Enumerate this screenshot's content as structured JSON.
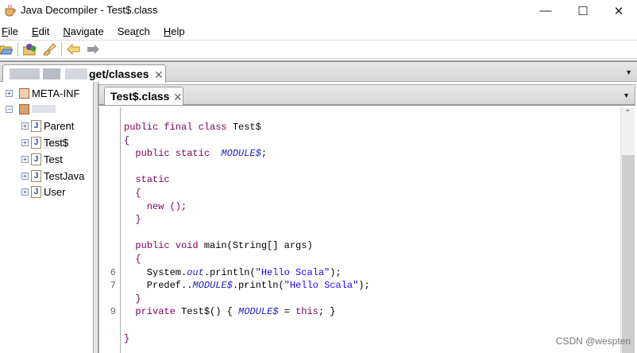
{
  "window": {
    "title": "Java Decompiler - Test$.class",
    "controls": [
      "minimize",
      "maximize",
      "close"
    ]
  },
  "menu": [
    {
      "label": "File",
      "mnemonic": "F",
      "rest": "ile"
    },
    {
      "label": "Edit",
      "mnemonic": "E",
      "rest": "dit"
    },
    {
      "label": "Navigate",
      "mnemonic": "N",
      "rest": "avigate"
    },
    {
      "label": "Search",
      "pre": "Sea",
      "mnemonic": "r",
      "rest": "ch"
    },
    {
      "label": "Help",
      "mnemonic": "H",
      "rest": "elp"
    }
  ],
  "toolbar": [
    "open-file-icon",
    "open-type-icon",
    "search-icon",
    "back-icon",
    "forward-icon"
  ],
  "outer_tab": {
    "label": "get/classes"
  },
  "tree": [
    {
      "label": "META-INF",
      "level": 0,
      "expanded": false,
      "icon": "package-icon"
    },
    {
      "label": "",
      "level": 0,
      "expanded": true,
      "icon": "package-icon"
    },
    {
      "label": "Parent",
      "level": 1,
      "icon": "java-class-icon"
    },
    {
      "label": "Test$",
      "level": 1,
      "icon": "java-class-icon",
      "selected": true
    },
    {
      "label": "Test",
      "level": 1,
      "icon": "java-class-icon"
    },
    {
      "label": "TestJava",
      "level": 1,
      "icon": "java-class-icon"
    },
    {
      "label": "User",
      "level": 1,
      "icon": "java-class-icon"
    }
  ],
  "editor_tab": {
    "label": "Test$.class"
  },
  "code": [
    {
      "ln": "",
      "t": [
        [
          "kw",
          "public final class "
        ],
        [
          "",
          "Test$"
        ]
      ]
    },
    {
      "ln": "",
      "t": [
        [
          "kw",
          "{"
        ]
      ]
    },
    {
      "ln": "",
      "t": [
        [
          "kw",
          "  public static  "
        ],
        [
          "fld",
          "MODULE$"
        ],
        [
          "",
          ";"
        ]
      ]
    },
    {
      "ln": "",
      "t": []
    },
    {
      "ln": "",
      "t": [
        [
          "kw",
          "  static"
        ]
      ]
    },
    {
      "ln": "",
      "t": [
        [
          "kw",
          "  {"
        ]
      ]
    },
    {
      "ln": "",
      "t": [
        [
          "kw",
          "    new ();"
        ]
      ]
    },
    {
      "ln": "",
      "t": [
        [
          "kw",
          "  }"
        ]
      ]
    },
    {
      "ln": "",
      "t": []
    },
    {
      "ln": "",
      "t": [
        [
          "kw",
          "  public void "
        ],
        [
          "",
          "main(String[] args)"
        ]
      ]
    },
    {
      "ln": "",
      "t": [
        [
          "kw",
          "  {"
        ]
      ]
    },
    {
      "ln": "6",
      "t": [
        [
          "",
          "    System."
        ],
        [
          "fld",
          "out"
        ],
        [
          "",
          ".println("
        ],
        [
          "str",
          "\"Hello Scala\""
        ],
        [
          "",
          ");"
        ]
      ]
    },
    {
      "ln": "7",
      "t": [
        [
          "",
          "    Predef.."
        ],
        [
          "fld",
          "MODULE$"
        ],
        [
          "",
          ".println("
        ],
        [
          "str",
          "\"Hello Scala\""
        ],
        [
          "",
          ");"
        ]
      ]
    },
    {
      "ln": "",
      "t": [
        [
          "kw",
          "  }"
        ]
      ]
    },
    {
      "ln": "9",
      "t": [
        [
          "kw",
          "  private "
        ],
        [
          "",
          "Test$() { "
        ],
        [
          "fld",
          "MODULE$"
        ],
        [
          "",
          " = "
        ],
        [
          "kw",
          "this"
        ],
        [
          "",
          "; }"
        ]
      ]
    },
    {
      "ln": "",
      "t": []
    },
    {
      "ln": "",
      "t": [
        [
          "kw",
          "}"
        ]
      ]
    }
  ],
  "watermark": "CSDN @wespten"
}
